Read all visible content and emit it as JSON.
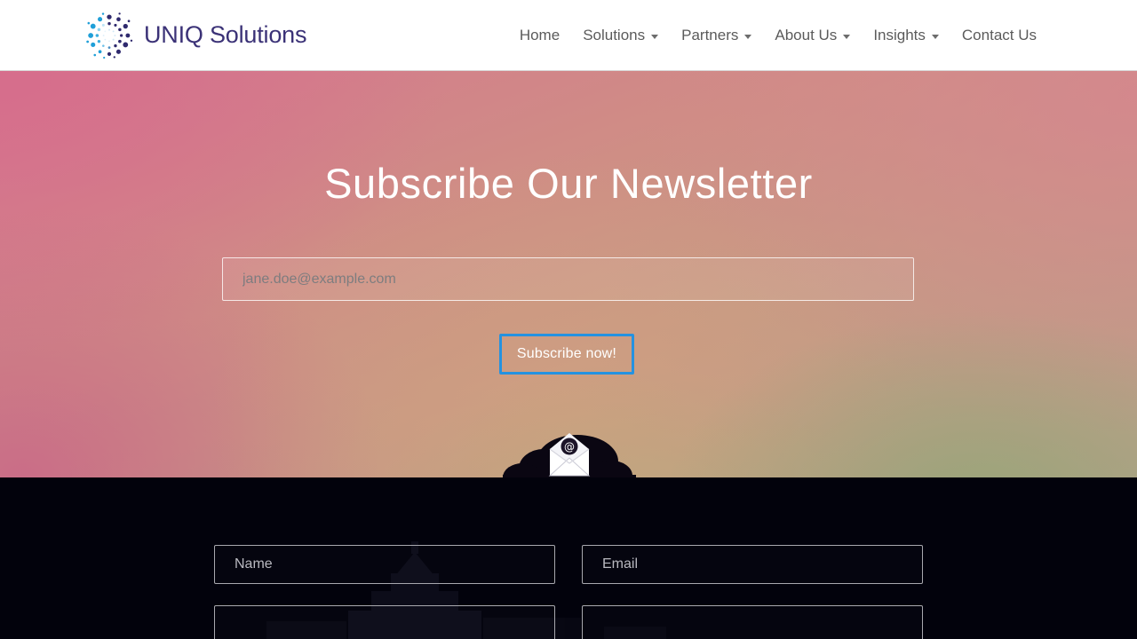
{
  "header": {
    "brand_name": "UNIQ Solutions",
    "brand_color": "#3b3277",
    "logo_colors": [
      "#1f9fd8",
      "#2f2a6e"
    ],
    "nav": [
      {
        "label": "Home",
        "has_caret": false
      },
      {
        "label": "Solutions",
        "has_caret": true
      },
      {
        "label": "Partners",
        "has_caret": true
      },
      {
        "label": "About Us",
        "has_caret": true
      },
      {
        "label": "Insights",
        "has_caret": true
      },
      {
        "label": "Contact Us",
        "has_caret": false
      }
    ]
  },
  "hero": {
    "title": "Subscribe Our Newsletter",
    "email_placeholder": "jane.doe@example.com",
    "email_value": "",
    "submit_label": "Subscribe now!",
    "submit_focus_color": "#2492e0",
    "gradient_from": "#d5778e",
    "gradient_mid": "#c79a84",
    "gradient_to": "#9aa285",
    "graphic": "cloud-envelope-at-icon"
  },
  "contact": {
    "background_color": "#02020c",
    "fields": [
      {
        "name": "name",
        "placeholder": "Name",
        "value": ""
      },
      {
        "name": "email",
        "placeholder": "Email",
        "value": ""
      },
      {
        "name": "field3",
        "placeholder": "",
        "value": ""
      },
      {
        "name": "field4",
        "placeholder": "",
        "value": ""
      }
    ]
  }
}
